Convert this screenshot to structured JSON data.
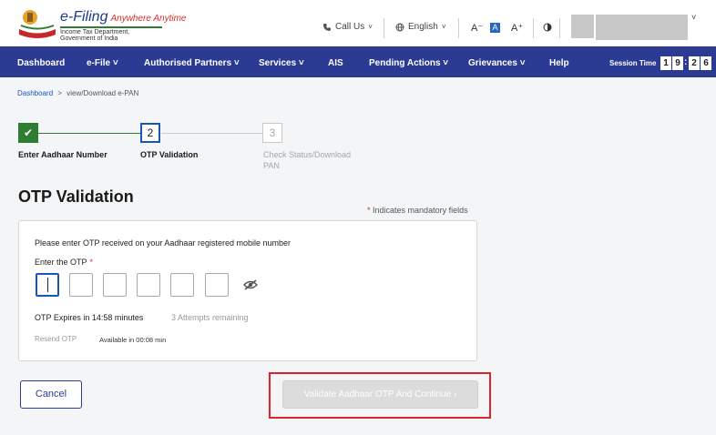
{
  "header": {
    "logo_title": "e-Filing",
    "logo_tagline": "Anywhere Anytime",
    "logo_subtitle": "Income Tax Department, Government of India",
    "call_us": "Call Us",
    "language": "English",
    "font_decrease": "A⁻",
    "font_default": "A",
    "font_increase": "A⁺"
  },
  "nav": {
    "items": [
      {
        "label": "Dashboard"
      },
      {
        "label": "e-File ˅"
      },
      {
        "label": "Authorised Partners ˅"
      },
      {
        "label": "Services ˅"
      },
      {
        "label": "AIS"
      },
      {
        "label": "Pending Actions ˅"
      },
      {
        "label": "Grievances ˅"
      },
      {
        "label": "Help"
      }
    ],
    "session_label": "Session Time",
    "session_digits": [
      "1",
      "9",
      "2",
      "6"
    ]
  },
  "breadcrumb": {
    "home": "Dashboard",
    "separator": ">",
    "current": "view/Download e-PAN"
  },
  "stepper": {
    "steps": [
      {
        "number": "✔",
        "label": "Enter Aadhaar Number",
        "state": "done"
      },
      {
        "number": "2",
        "label": "OTP Validation",
        "state": "active"
      },
      {
        "number": "3",
        "label_line1": "Check Status/Download",
        "label_line2": "PAN",
        "state": "future"
      }
    ]
  },
  "page": {
    "title": "OTP Validation",
    "mandatory_star": "*",
    "mandatory_note": "Indicates mandatory fields"
  },
  "otp_card": {
    "instruction": "Please enter OTP received on your Aadhaar registered mobile number",
    "otp_label": "Enter the OTP",
    "required_star": "*",
    "otp_digit_count": 6,
    "expires_text": "OTP Expires in 14:58 minutes",
    "attempts_text": "3 Attempts remaining",
    "resend_label": "Resend OTP",
    "available_text": "Available in 00:08 min"
  },
  "actions": {
    "cancel_label": "Cancel",
    "validate_label": "Validate Aadhaar OTP And Continue  ›"
  },
  "colors": {
    "nav_bg": "#2b3a92",
    "step_done": "#2e7d32",
    "step_active_border": "#1a56b8",
    "highlight_border": "#d9232e",
    "disabled_button": "#dcdcdc"
  }
}
